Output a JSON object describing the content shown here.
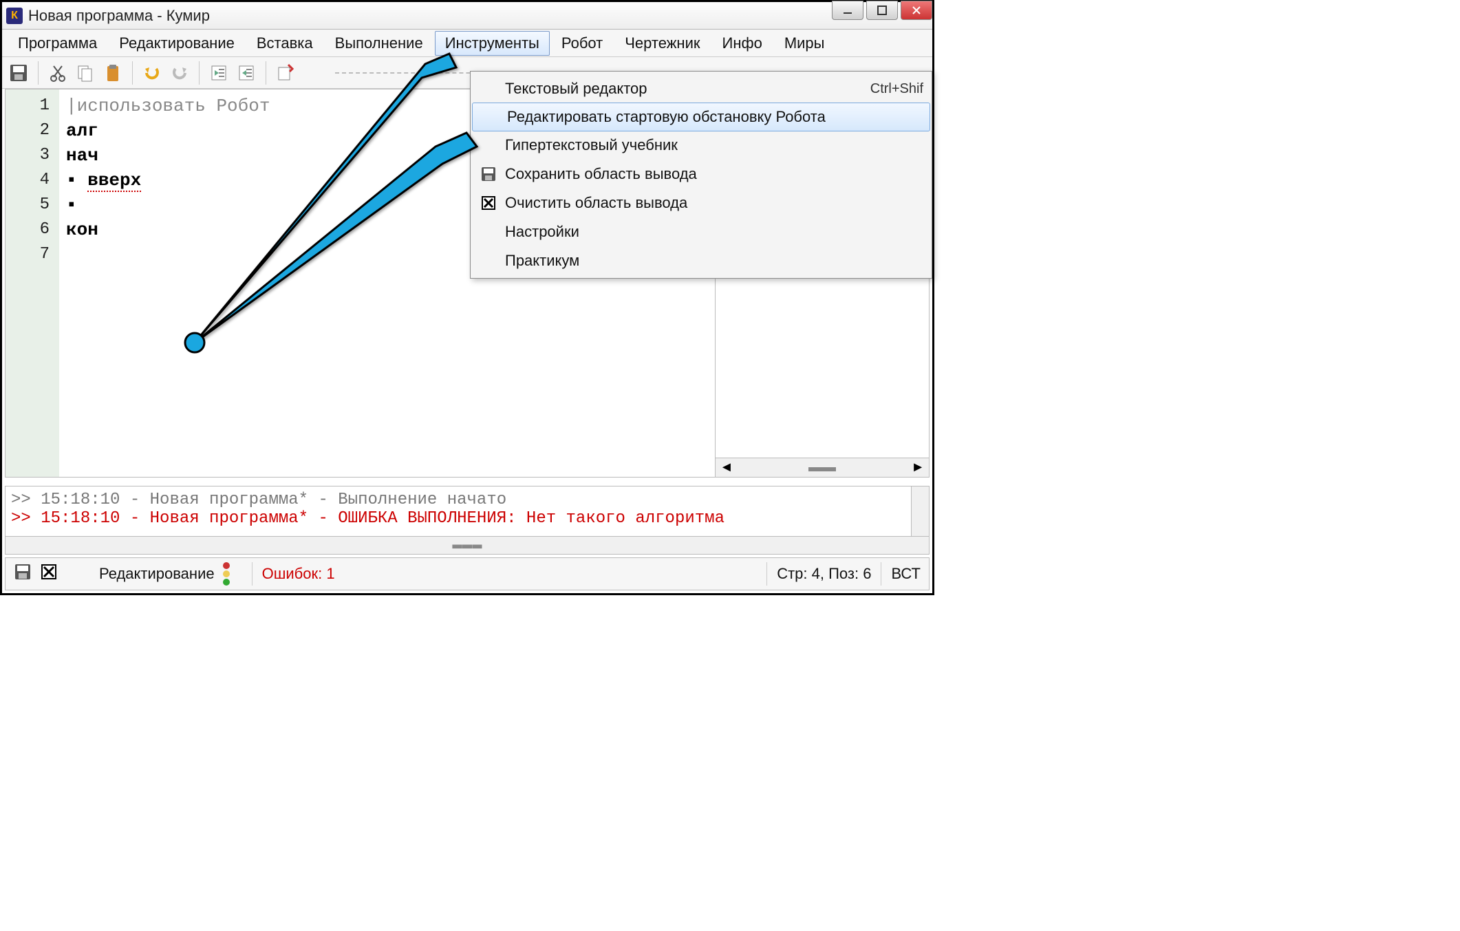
{
  "title": "Новая программа - Кумир",
  "app_icon_letter": "К",
  "menubar": {
    "items": [
      "Программа",
      "Редактирование",
      "Вставка",
      "Выполнение",
      "Инструменты",
      "Робот",
      "Чертежник",
      "Инфо",
      "Миры"
    ],
    "active_index": 4
  },
  "dropdown": {
    "items": [
      {
        "label": "Текстовый редактор",
        "shortcut": "Ctrl+Shif",
        "icon": ""
      },
      {
        "label": "Редактировать стартовую обстановку Робота",
        "shortcut": "",
        "icon": "",
        "hover": true
      },
      {
        "label": "Гипертекстовый учебник",
        "shortcut": "",
        "icon": ""
      },
      {
        "label": "Сохранить область вывода",
        "shortcut": "",
        "icon": "save"
      },
      {
        "label": "Очистить область вывода",
        "shortcut": "",
        "icon": "clear"
      },
      {
        "label": "Настройки",
        "shortcut": "",
        "icon": ""
      },
      {
        "label": "Практикум",
        "shortcut": "",
        "icon": ""
      }
    ]
  },
  "editor": {
    "gutter": [
      "1",
      "2",
      "3",
      "4",
      "5",
      "6",
      "7"
    ],
    "lines": [
      {
        "type": "comment",
        "text": "использовать Робот",
        "prefix": "|"
      },
      {
        "type": "kw",
        "text": "алг"
      },
      {
        "type": "kw",
        "text": "нач"
      },
      {
        "type": "bullet",
        "text": "вверх",
        "underline": true
      },
      {
        "type": "bullet",
        "text": ""
      },
      {
        "type": "kw",
        "text": "кон"
      },
      {
        "type": "",
        "text": ""
      }
    ]
  },
  "output": {
    "line1": ">> 15:18:10 - Новая программа* - Выполнение начато",
    "line2": ">> 15:18:10 - Новая программа* - ОШИБКА ВЫПОЛНЕНИЯ: Нет такого алгоритма"
  },
  "statusbar": {
    "mode": "Редактирование",
    "errors": "Ошибок: 1",
    "position": "Стр: 4, Поз: 6",
    "insert": "ВСТ"
  }
}
